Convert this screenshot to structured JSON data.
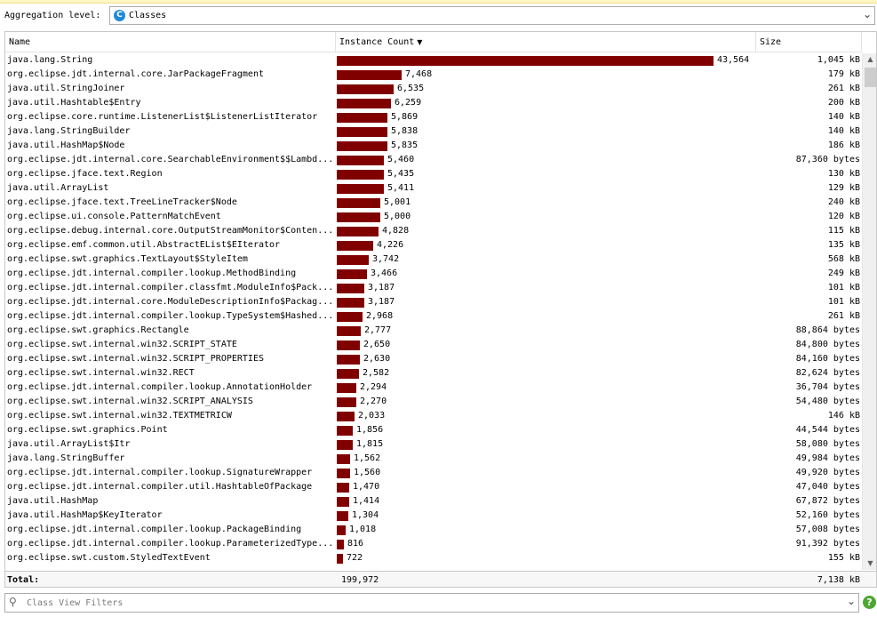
{
  "aggregation": {
    "label": "Aggregation level:",
    "value": "Classes",
    "icon": "class-c-icon"
  },
  "table": {
    "headers": {
      "name": "Name",
      "count": "Instance Count",
      "size": "Size"
    },
    "rows": [
      {
        "name": "java.lang.String",
        "count": "43,564",
        "value": 43564,
        "size": "1,045 kB"
      },
      {
        "name": "org.eclipse.jdt.internal.core.JarPackageFragment",
        "count": "7,468",
        "value": 7468,
        "size": "179 kB"
      },
      {
        "name": "java.util.StringJoiner",
        "count": "6,535",
        "value": 6535,
        "size": "261 kB"
      },
      {
        "name": "java.util.Hashtable$Entry",
        "count": "6,259",
        "value": 6259,
        "size": "200 kB"
      },
      {
        "name": "org.eclipse.core.runtime.ListenerList$ListenerListIterator",
        "count": "5,869",
        "value": 5869,
        "size": "140 kB"
      },
      {
        "name": "java.lang.StringBuilder",
        "count": "5,838",
        "value": 5838,
        "size": "140 kB"
      },
      {
        "name": "java.util.HashMap$Node",
        "count": "5,835",
        "value": 5835,
        "size": "186 kB"
      },
      {
        "name": "org.eclipse.jdt.internal.core.SearchableEnvironment$$Lambd...",
        "count": "5,460",
        "value": 5460,
        "size": "87,360 bytes"
      },
      {
        "name": "org.eclipse.jface.text.Region",
        "count": "5,435",
        "value": 5435,
        "size": "130 kB"
      },
      {
        "name": "java.util.ArrayList",
        "count": "5,411",
        "value": 5411,
        "size": "129 kB"
      },
      {
        "name": "org.eclipse.jface.text.TreeLineTracker$Node",
        "count": "5,001",
        "value": 5001,
        "size": "240 kB"
      },
      {
        "name": "org.eclipse.ui.console.PatternMatchEvent",
        "count": "5,000",
        "value": 5000,
        "size": "120 kB"
      },
      {
        "name": "org.eclipse.debug.internal.core.OutputStreamMonitor$Conten...",
        "count": "4,828",
        "value": 4828,
        "size": "115 kB"
      },
      {
        "name": "org.eclipse.emf.common.util.AbstractEList$EIterator",
        "count": "4,226",
        "value": 4226,
        "size": "135 kB"
      },
      {
        "name": "org.eclipse.swt.graphics.TextLayout$StyleItem",
        "count": "3,742",
        "value": 3742,
        "size": "568 kB"
      },
      {
        "name": "org.eclipse.jdt.internal.compiler.lookup.MethodBinding",
        "count": "3,466",
        "value": 3466,
        "size": "249 kB"
      },
      {
        "name": "org.eclipse.jdt.internal.compiler.classfmt.ModuleInfo$Pack...",
        "count": "3,187",
        "value": 3187,
        "size": "101 kB"
      },
      {
        "name": "org.eclipse.jdt.internal.core.ModuleDescriptionInfo$Packag...",
        "count": "3,187",
        "value": 3187,
        "size": "101 kB"
      },
      {
        "name": "org.eclipse.jdt.internal.compiler.lookup.TypeSystem$Hashed...",
        "count": "2,968",
        "value": 2968,
        "size": "261 kB"
      },
      {
        "name": "org.eclipse.swt.graphics.Rectangle",
        "count": "2,777",
        "value": 2777,
        "size": "88,864 bytes"
      },
      {
        "name": "org.eclipse.swt.internal.win32.SCRIPT_STATE",
        "count": "2,650",
        "value": 2650,
        "size": "84,800 bytes"
      },
      {
        "name": "org.eclipse.swt.internal.win32.SCRIPT_PROPERTIES",
        "count": "2,630",
        "value": 2630,
        "size": "84,160 bytes"
      },
      {
        "name": "org.eclipse.swt.internal.win32.RECT",
        "count": "2,582",
        "value": 2582,
        "size": "82,624 bytes"
      },
      {
        "name": "org.eclipse.jdt.internal.compiler.lookup.AnnotationHolder",
        "count": "2,294",
        "value": 2294,
        "size": "36,704 bytes"
      },
      {
        "name": "org.eclipse.swt.internal.win32.SCRIPT_ANALYSIS",
        "count": "2,270",
        "value": 2270,
        "size": "54,480 bytes"
      },
      {
        "name": "org.eclipse.swt.internal.win32.TEXTMETRICW",
        "count": "2,033",
        "value": 2033,
        "size": "146 kB"
      },
      {
        "name": "org.eclipse.swt.graphics.Point",
        "count": "1,856",
        "value": 1856,
        "size": "44,544 bytes"
      },
      {
        "name": "java.util.ArrayList$Itr",
        "count": "1,815",
        "value": 1815,
        "size": "58,080 bytes"
      },
      {
        "name": "java.lang.StringBuffer",
        "count": "1,562",
        "value": 1562,
        "size": "49,984 bytes"
      },
      {
        "name": "org.eclipse.jdt.internal.compiler.lookup.SignatureWrapper",
        "count": "1,560",
        "value": 1560,
        "size": "49,920 bytes"
      },
      {
        "name": "org.eclipse.jdt.internal.compiler.util.HashtableOfPackage",
        "count": "1,470",
        "value": 1470,
        "size": "47,040 bytes"
      },
      {
        "name": "java.util.HashMap",
        "count": "1,414",
        "value": 1414,
        "size": "67,872 bytes"
      },
      {
        "name": "java.util.HashMap$KeyIterator",
        "count": "1,304",
        "value": 1304,
        "size": "52,160 bytes"
      },
      {
        "name": "org.eclipse.jdt.internal.compiler.lookup.PackageBinding",
        "count": "1,018",
        "value": 1018,
        "size": "57,008 bytes"
      },
      {
        "name": "org.eclipse.jdt.internal.compiler.lookup.ParameterizedType...",
        "count": "816",
        "value": 816,
        "size": "91,392 bytes"
      },
      {
        "name": "org.eclipse.swt.custom.StyledTextEvent",
        "count": "722",
        "value": 722,
        "size": "155 kB"
      }
    ],
    "total": {
      "label": "Total:",
      "count": "199,972",
      "size": "7,138 kB"
    },
    "bar_color": "#800000"
  },
  "filter": {
    "placeholder": "Class View Filters",
    "icon": "search-icon"
  },
  "help": {
    "label": "?",
    "icon": "help-icon"
  }
}
